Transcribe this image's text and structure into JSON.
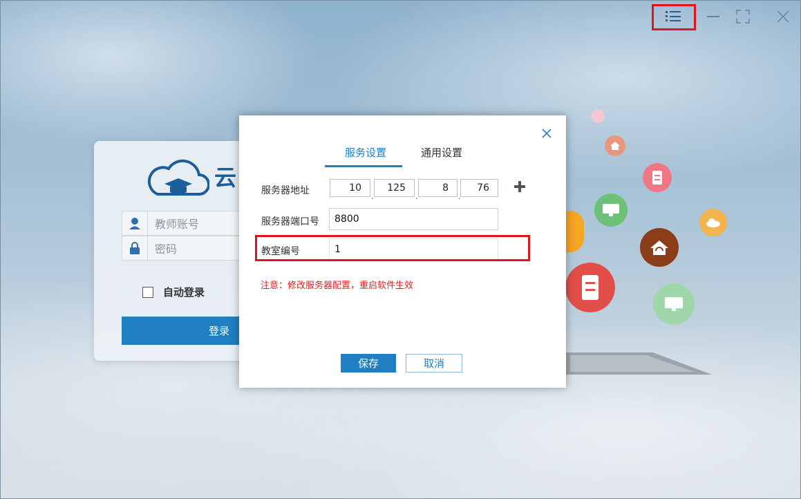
{
  "window": {
    "controls": {
      "menu_icon": "list-menu-icon",
      "minimize_icon": "minimize-icon",
      "maximize_icon": "maximize-icon",
      "close_icon": "close-icon"
    }
  },
  "login": {
    "logo_text": "云",
    "username_placeholder": "教师账号",
    "password_placeholder": "密码",
    "auto_login_label": "自动登录",
    "login_button": "登录"
  },
  "dialog": {
    "tabs": [
      {
        "label": "服务设置",
        "active": true
      },
      {
        "label": "通用设置",
        "active": false
      }
    ],
    "server_address_label": "服务器地址",
    "ip": [
      "10",
      "125",
      "8",
      "76"
    ],
    "ip_separator": ".",
    "server_port_label": "服务器端口号",
    "server_port_value": "8800",
    "classroom_id_label": "教室编号",
    "classroom_id_value": "1",
    "notice": "注意：修改服务器配置，重启软件生效",
    "save_button": "保存",
    "cancel_button": "取消"
  },
  "colors": {
    "accent": "#1f7fc1",
    "highlight": "#e0141b",
    "notice": "#e02020"
  }
}
